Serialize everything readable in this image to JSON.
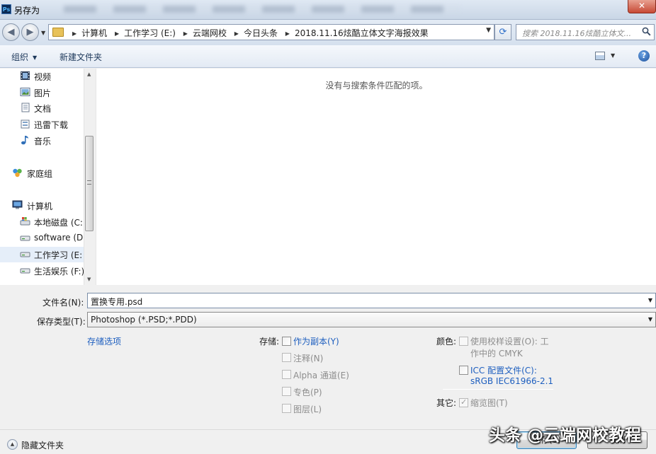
{
  "window": {
    "title": "另存为",
    "app_icon_text": "Ps",
    "close_glyph": "✕"
  },
  "address_bar": {
    "breadcrumbs": [
      "计算机",
      "工作学习 (E:)",
      "云端网校",
      "今日头条",
      "2018.11.16炫酷立体文字海报效果"
    ],
    "search_placeholder": "搜索 2018.11.16炫酷立体文..."
  },
  "toolbar": {
    "organize_label": "组织",
    "new_folder_label": "新建文件夹",
    "help_glyph": "?"
  },
  "nav_pane": {
    "items": [
      {
        "label": "视频",
        "icon": "video-icon"
      },
      {
        "label": "图片",
        "icon": "pictures-icon"
      },
      {
        "label": "文档",
        "icon": "documents-icon"
      },
      {
        "label": "迅雷下载",
        "icon": "download-icon"
      },
      {
        "label": "音乐",
        "icon": "music-icon"
      },
      {
        "label": "家庭组",
        "icon": "homegroup-icon"
      },
      {
        "label": "计算机",
        "icon": "computer-icon"
      },
      {
        "label": "本地磁盘 (C:",
        "icon": "system-drive-icon"
      },
      {
        "label": "software (D",
        "icon": "drive-icon"
      },
      {
        "label": "工作学习 (E:",
        "icon": "drive-icon",
        "selected": true
      },
      {
        "label": "生活娱乐 (F:)",
        "icon": "drive-icon"
      }
    ]
  },
  "content": {
    "empty_message": "没有与搜索条件匹配的项。"
  },
  "form": {
    "filename_label": "文件名(N):",
    "filename_value": "置换专用.psd",
    "filetype_label": "保存类型(T):",
    "filetype_value": "Photoshop (*.PSD;*.PDD)",
    "save_options_link": "存储选项",
    "storage_label": "存储:",
    "storage_options": [
      {
        "label": "作为副本(Y)",
        "enabled": true,
        "checked": false
      },
      {
        "label": "注释(N)",
        "enabled": false,
        "checked": false
      },
      {
        "label": "Alpha 通道(E)",
        "enabled": false,
        "checked": false
      },
      {
        "label": "专色(P)",
        "enabled": false,
        "checked": false
      },
      {
        "label": "图层(L)",
        "enabled": false,
        "checked": false
      }
    ],
    "color_label": "颜色:",
    "proof_setup_line1": "使用校样设置(O):  工",
    "proof_setup_line2": "作中的 CMYK",
    "icc_line1": "ICC 配置文件(C):",
    "icc_line2": "sRGB IEC61966-2.1",
    "other_label": "其它:",
    "thumbnail_label": "缩览图(T)",
    "thumbnail_checked": true
  },
  "footer": {
    "hide_folders_label": "隐藏文件夹",
    "save_button": "保存(S)",
    "cancel_button": "取消"
  },
  "watermark": {
    "text": "头条 @云端网校教程"
  }
}
